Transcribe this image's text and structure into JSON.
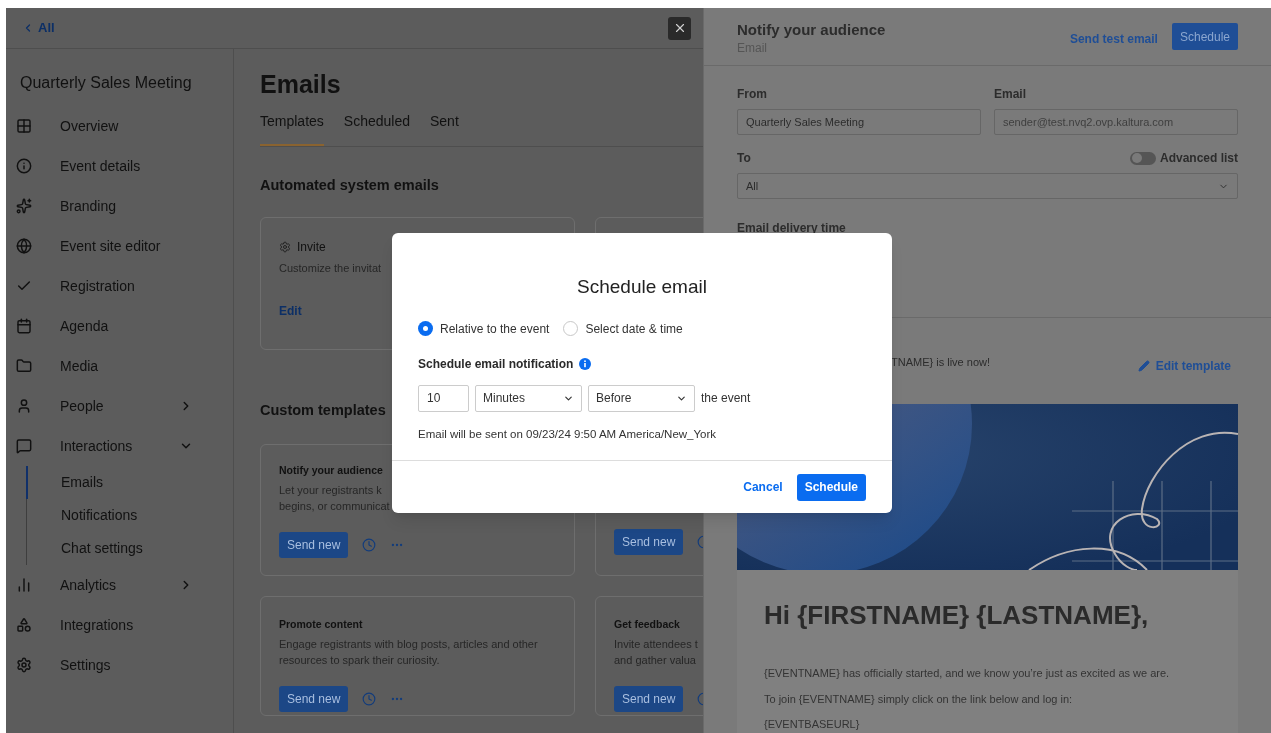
{
  "top_bar": {
    "back_label": "All"
  },
  "sidebar": {
    "title": "Quarterly Sales Meeting",
    "items": [
      {
        "label": "Overview"
      },
      {
        "label": "Event details"
      },
      {
        "label": "Branding"
      },
      {
        "label": "Event site editor"
      },
      {
        "label": "Registration"
      },
      {
        "label": "Agenda"
      },
      {
        "label": "Media"
      },
      {
        "label": "People",
        "expanded": false
      },
      {
        "label": "Interactions",
        "expanded": true,
        "children": [
          {
            "label": "Emails",
            "selected": true
          },
          {
            "label": "Notifications",
            "selected": false
          },
          {
            "label": "Chat settings",
            "selected": false
          }
        ]
      },
      {
        "label": "Analytics",
        "expanded": false
      },
      {
        "label": "Integrations"
      },
      {
        "label": "Settings"
      }
    ]
  },
  "main": {
    "title": "Emails",
    "tabs": [
      {
        "label": "Templates",
        "selected": true
      },
      {
        "label": "Scheduled",
        "selected": false
      },
      {
        "label": "Sent",
        "selected": false
      }
    ],
    "sections": [
      {
        "title": "Automated system emails",
        "cards": [
          {
            "kind": "automated",
            "title": "Invite",
            "description_lines": [
              "Customize the invitat"
            ],
            "action": "Edit"
          },
          {
            "kind": "automated"
          }
        ]
      },
      {
        "title": "Custom templates",
        "cards": [
          {
            "kind": "custom",
            "title": "Notify your audience",
            "description_lines": [
              "Let your registrants k",
              "begins, or communicat"
            ],
            "action": "Send new"
          },
          {
            "kind": "custom",
            "action": "Send new"
          },
          {
            "kind": "custom",
            "title": "Promote content",
            "description_lines": [
              "Engage registrants with blog posts, articles and other",
              "resources to spark their curiosity."
            ],
            "action": "Send new"
          },
          {
            "kind": "custom",
            "title": "Get feedback",
            "description_lines": [
              "Invite attendees t",
              "and gather valua"
            ],
            "action": "Send new"
          }
        ]
      }
    ]
  },
  "drawer": {
    "title": "Notify your audience",
    "subtitle": "Email",
    "test_link": "Send test email",
    "schedule_button": "Schedule",
    "from_label": "From",
    "from_value": "Quarterly Sales Meeting",
    "email_label": "Email",
    "email_placeholder": "sender@test.nvq2.ovp.kaltura.com",
    "to_label": "To",
    "advanced_list": {
      "label": "Advanced list",
      "on": false
    },
    "to_value": "All",
    "delivery_label": "Email delivery time",
    "subject_preview": "TNAME} is live now!",
    "edit_template": "Edit template",
    "email_heading": "Hi {FIRSTNAME} {LASTNAME},",
    "email_paragraphs": [
      "{EVENTNAME} has officially started, and we know you’re just as excited as we are.",
      "To join {EVENTNAME} simply click on the link below and log in:",
      "{EVENTBASEURL}"
    ]
  },
  "modal": {
    "title": "Schedule email",
    "options": [
      {
        "label": "Relative to the event",
        "selected": true
      },
      {
        "label": "Select date & time",
        "selected": false
      }
    ],
    "notification_label": "Schedule email notification",
    "amount": "10",
    "unit": "Minutes",
    "direction": "Before",
    "suffix": "the event",
    "summary": "Email will be sent on 09/23/24 9:50 AM America/New_York",
    "cancel": "Cancel",
    "confirm": "Schedule"
  }
}
